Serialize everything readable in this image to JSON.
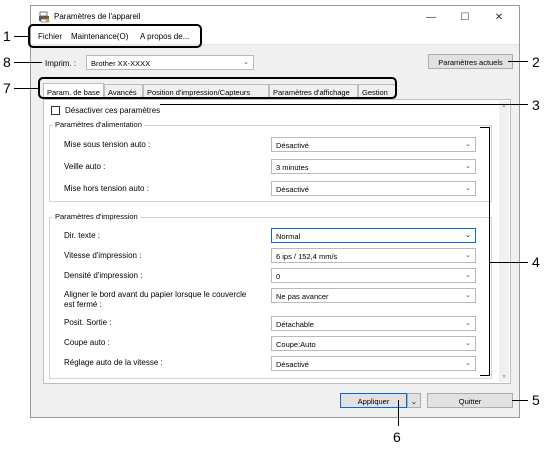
{
  "window": {
    "title": "Paramètres de l'appareil",
    "min": "—",
    "max": "☐",
    "close": "✕"
  },
  "menu": {
    "file": "Fichier",
    "maintenance": "Maintenance(O)",
    "about": "A propos de..."
  },
  "printer": {
    "label": "Imprim. :",
    "value": "Brother  XX-XXXX"
  },
  "current_settings_button": "Paramètres actuels",
  "tabs": [
    "Param. de base",
    "Avancés",
    "Position d'impression/Capteurs",
    "Paramètres d'affichage",
    "Gestion"
  ],
  "disable_checkbox_label": "Désactiver ces paramètres",
  "power_group": {
    "title": "Paramètres d'alimentation",
    "rows": [
      {
        "label": "Mise sous tension auto :",
        "value": "Désactivé"
      },
      {
        "label": "Veille auto :",
        "value": "3 minutes"
      },
      {
        "label": "Mise hors tension auto :",
        "value": "Désactivé"
      }
    ]
  },
  "print_group": {
    "title": "Paramètres d'impression",
    "rows": [
      {
        "label": "Dir. texte :",
        "value": "Normal"
      },
      {
        "label": "Vitesse d'impression :",
        "value": "6 ips / 152,4 mm/s"
      },
      {
        "label": "Densité d'impression :",
        "value": "0"
      },
      {
        "label": "Aligner le bord avant du papier lorsque le couvercle",
        "label2": "est fermé :",
        "value": "Ne pas avancer"
      },
      {
        "label": "Posit. Sortie :",
        "value": "Détachable"
      },
      {
        "label": "Coupe auto :",
        "value": "Coupe:Auto"
      },
      {
        "label": "Réglage auto de la vitesse :",
        "value": "Désactivé"
      }
    ]
  },
  "apply_button": "Appliquer",
  "quit_button": "Quitter",
  "callouts": [
    "1",
    "2",
    "3",
    "4",
    "5",
    "6",
    "7",
    "8"
  ]
}
